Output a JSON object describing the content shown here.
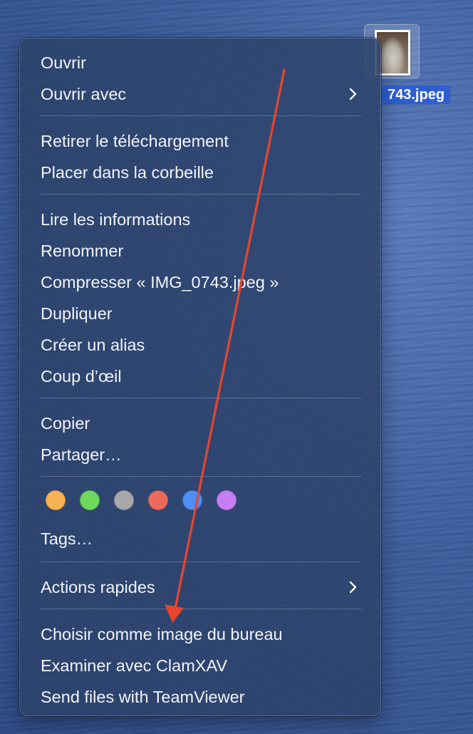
{
  "desktop": {
    "file_label": "743.jpeg"
  },
  "menu": {
    "group1": {
      "open": "Ouvrir",
      "open_with": "Ouvrir avec"
    },
    "group2": {
      "remove_download": "Retirer le téléchargement",
      "move_to_trash": "Placer dans la corbeille"
    },
    "group3": {
      "get_info": "Lire les informations",
      "rename": "Renommer",
      "compress": "Compresser « IMG_0743.jpeg »",
      "duplicate": "Dupliquer",
      "make_alias": "Créer un alias",
      "quick_look": "Coup d’œil"
    },
    "group4": {
      "copy": "Copier",
      "share": "Partager…"
    },
    "tags": {
      "colors": [
        "#f6b352",
        "#6ed85d",
        "#a8a8ab",
        "#ee6a5c",
        "#4e8ef7",
        "#c77ef3"
      ],
      "label": "Tags…"
    },
    "group5": {
      "quick_actions": "Actions rapides"
    },
    "group6": {
      "set_desktop_picture": "Choisir comme image du bureau",
      "scan_clamxav": "Examiner avec ClamXAV",
      "send_teamviewer": "Send files with TeamViewer"
    }
  },
  "annotation": {
    "arrow_color": "#e8452c"
  }
}
